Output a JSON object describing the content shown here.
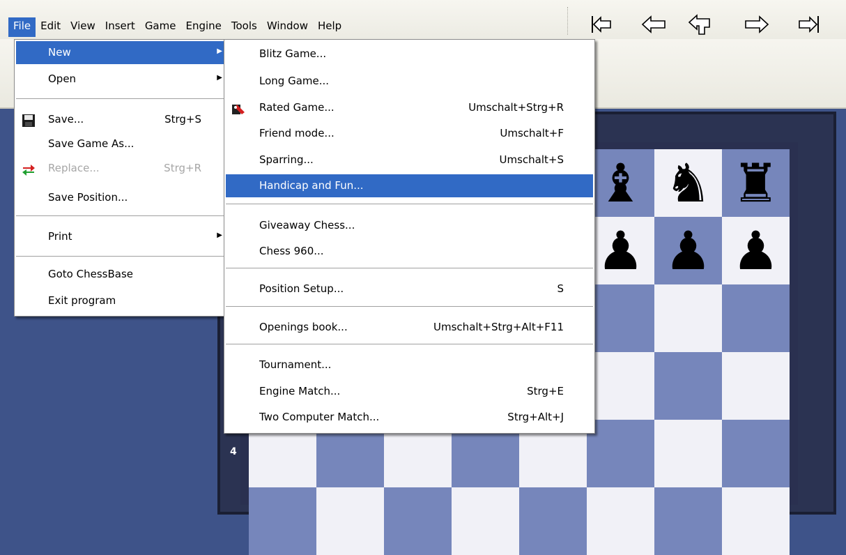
{
  "menubar": {
    "items": [
      "File",
      "Edit",
      "View",
      "Insert",
      "Game",
      "Engine",
      "Tools",
      "Window",
      "Help"
    ],
    "active": "File"
  },
  "nav_icons": [
    "first-move-icon",
    "previous-move-icon",
    "take-back-icon",
    "next-move-icon",
    "last-move-icon"
  ],
  "file_menu": {
    "new": "New",
    "open": "Open",
    "save": "Save...",
    "save_shortcut": "Strg+S",
    "save_game_as": "Save Game As...",
    "replace": "Replace...",
    "replace_shortcut": "Strg+R",
    "save_position": "Save Position...",
    "print": "Print",
    "goto_chessbase": "Goto ChessBase",
    "exit_program": "Exit program"
  },
  "new_menu": {
    "blitz_game": "Blitz Game...",
    "long_game": "Long Game...",
    "rated_game": "Rated Game...",
    "rated_game_shortcut": "Umschalt+Strg+R",
    "friend_mode": "Friend mode...",
    "friend_mode_shortcut": "Umschalt+F",
    "sparring": "Sparring...",
    "sparring_shortcut": "Umschalt+S",
    "handicap": "Handicap and Fun...",
    "giveaway": "Giveaway Chess...",
    "chess960": "Chess 960...",
    "position_setup": "Position Setup...",
    "position_setup_shortcut": "S",
    "openings_book": "Openings book...",
    "openings_book_shortcut": "Umschalt+Strg+Alt+F11",
    "tournament": "Tournament...",
    "engine_match": "Engine Match...",
    "engine_match_shortcut": "Strg+E",
    "two_computer_match": "Two Computer Match...",
    "two_computer_match_shortcut": "Strg+Alt+J"
  },
  "board": {
    "rank_label": "4",
    "light_color": "#f1f1f7",
    "dark_color": "#7686bb"
  },
  "colors": {
    "highlight": "#316ac5",
    "menubar": "#ecebe3"
  }
}
